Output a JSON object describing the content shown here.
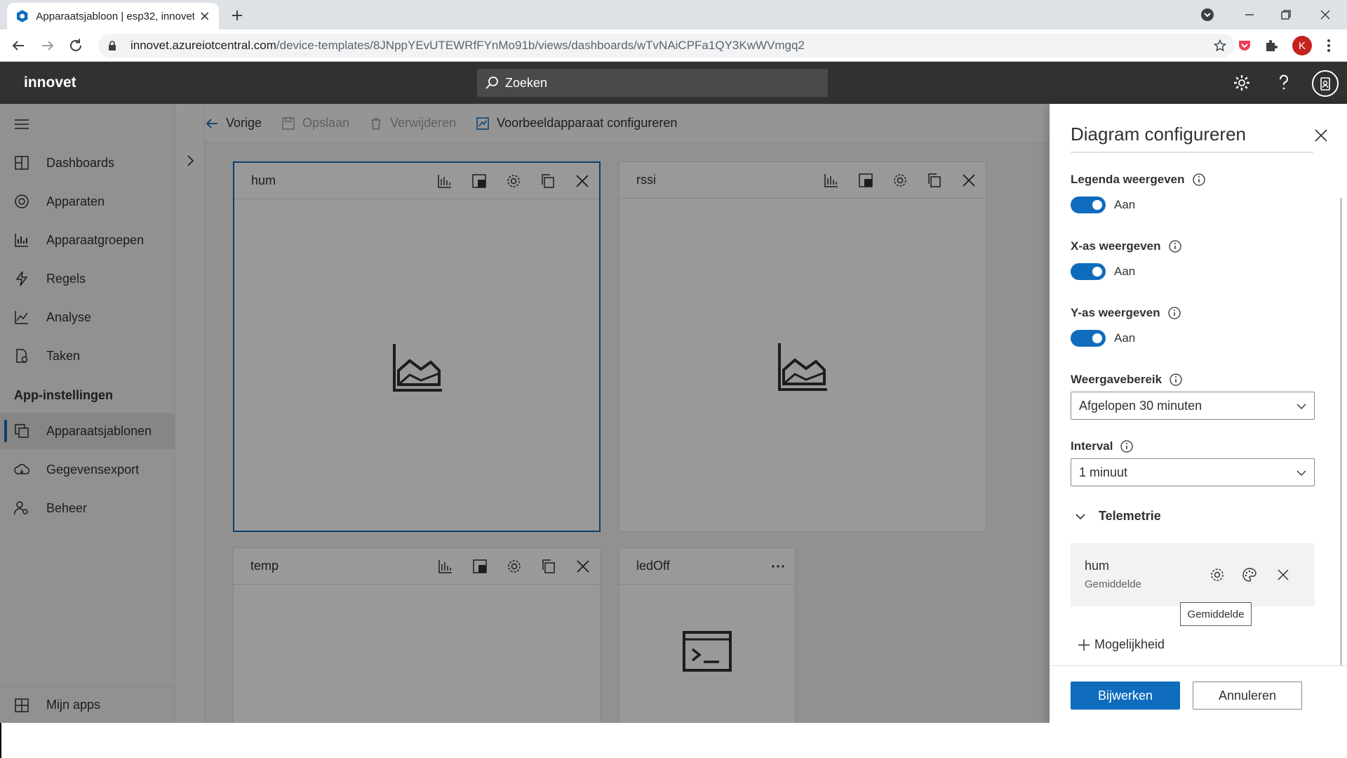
{
  "browser": {
    "tab_title": "Apparaatsjabloon | esp32, innovet",
    "url_host": "innovet.azureiotcentral.com",
    "url_path": "/device-templates/8JNppYEvUTEWRfFYnMo91b/views/dashboards/wTvNAiCPFa1QY3KwWVmgq2",
    "profile_initial": "K"
  },
  "header": {
    "brand": "innovet",
    "search_placeholder": "Zoeken"
  },
  "sidebar": {
    "items": [
      {
        "label": "Dashboards",
        "icon": "dashboard-icon"
      },
      {
        "label": "Apparaten",
        "icon": "devices-icon"
      },
      {
        "label": "Apparaatgroepen",
        "icon": "device-groups-icon"
      },
      {
        "label": "Regels",
        "icon": "rules-icon"
      },
      {
        "label": "Analyse",
        "icon": "analytics-icon"
      },
      {
        "label": "Taken",
        "icon": "jobs-icon"
      }
    ],
    "section_heading": "App-instellingen",
    "settings_items": [
      {
        "label": "Apparaatsjablonen",
        "icon": "device-templates-icon",
        "active": true
      },
      {
        "label": "Gegevensexport",
        "icon": "data-export-icon"
      },
      {
        "label": "Beheer",
        "icon": "administration-icon"
      }
    ],
    "bottom_item": "Mijn apps"
  },
  "commandbar": {
    "back": "Vorige",
    "save": "Opslaan",
    "delete": "Verwijderen",
    "configure_sample": "Voorbeeldapparaat configureren"
  },
  "tiles": [
    {
      "title": "hum"
    },
    {
      "title": "rssi"
    },
    {
      "title": "temp"
    },
    {
      "title": "ledOff"
    }
  ],
  "panel": {
    "title": "Diagram configureren",
    "legend": {
      "label": "Legenda weergeven",
      "state": "Aan"
    },
    "xaxis": {
      "label": "X-as weergeven",
      "state": "Aan"
    },
    "yaxis": {
      "label": "Y-as weergeven",
      "state": "Aan"
    },
    "range": {
      "label": "Weergavebereik",
      "value": "Afgelopen 30 minuten"
    },
    "interval": {
      "label": "Interval",
      "value": "1 minuut"
    },
    "telemetry_section": "Telemetrie",
    "telemetry": {
      "name": "hum",
      "aggregation": "Gemiddelde",
      "tooltip": "Gemiddelde"
    },
    "add_capability": "Mogelijkheid",
    "update_button": "Bijwerken",
    "cancel_button": "Annuleren"
  },
  "colors": {
    "accent": "#0f6cbd",
    "header_bg": "#323130",
    "profile": "#c5221f"
  }
}
